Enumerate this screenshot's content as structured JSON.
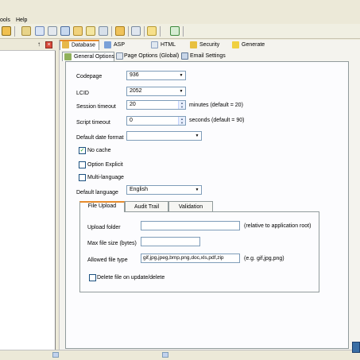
{
  "menu": [
    "ools",
    "Help"
  ],
  "top_tabs": [
    {
      "label": "Database",
      "icon": "database-icon"
    },
    {
      "label": "ASP",
      "icon": "asp-icon"
    },
    {
      "label": "HTML",
      "icon": "html-icon"
    },
    {
      "label": "Security",
      "icon": "lock-icon"
    },
    {
      "label": "Generate",
      "icon": "lightning-icon"
    }
  ],
  "sub_tabs": [
    {
      "label": "General Options",
      "icon": "settings-icon"
    },
    {
      "label": "Page Options (Global)",
      "icon": "page-icon"
    },
    {
      "label": "Email Settings",
      "icon": "email-icon"
    }
  ],
  "form": {
    "codepage_label": "Codepage",
    "codepage_value": "936",
    "lcid_label": "LCID",
    "lcid_value": "2052",
    "session_timeout_label": "Session timeout",
    "session_timeout_value": "20",
    "session_timeout_hint": "minutes (default = 20)",
    "script_timeout_label": "Script timeout",
    "script_timeout_value": "0",
    "script_timeout_hint": "seconds (default = 90)",
    "date_format_label": "Default date format",
    "date_format_value": "",
    "no_cache_label": "No cache",
    "no_cache_checked": true,
    "option_explicit_label": "Option Explicit",
    "option_explicit_checked": false,
    "multi_language_label": "Multi-language",
    "multi_language_checked": false,
    "default_language_label": "Default language",
    "default_language_value": "English"
  },
  "inner_tabs": [
    "File Upload",
    "Audit Trail",
    "Validation"
  ],
  "upload": {
    "upload_folder_label": "Upload folder",
    "upload_folder_value": "",
    "upload_folder_hint": "(relative to application root)",
    "max_size_label": "Max file size (bytes)",
    "max_size_value": "",
    "allowed_type_label": "Allowed file type",
    "allowed_type_value": "gif,jpg,jpeg,bmp,png,doc,xls,pdf,zip",
    "allowed_type_hint": "(e.g. gif,jpg,png)",
    "delete_file_label": "Delete file on update/delete",
    "delete_file_checked": false
  },
  "colors": {
    "window_bg": "#ece9d8",
    "active_tab_accent": "#e68b2c",
    "field_border": "#7f9db9",
    "check_green": "#21a121"
  }
}
